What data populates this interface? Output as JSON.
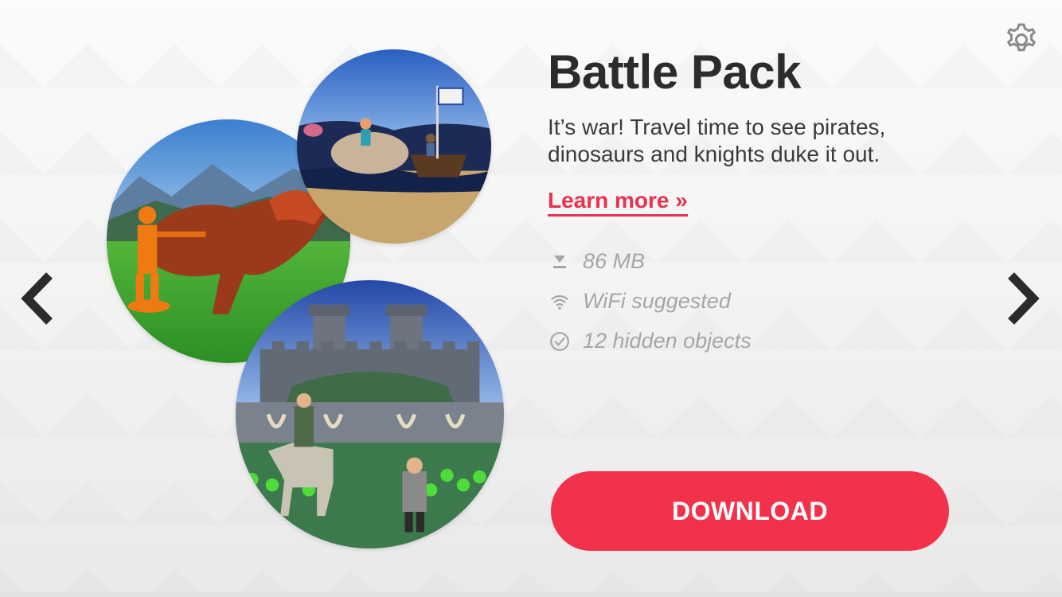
{
  "pack": {
    "title": "Battle Pack",
    "description": "It’s war! Travel time to see pirates, dinosaurs and knights duke it out.",
    "learn_more": "Learn more »",
    "info": {
      "size": "86 MB",
      "connection": "WiFi suggested",
      "hidden_objects": "12 hidden objects"
    },
    "download_label": "DOWNLOAD"
  },
  "icons": {
    "settings": "gear-icon",
    "prev": "chevron-left-icon",
    "next": "chevron-right-icon",
    "size": "download-icon",
    "connection": "wifi-icon",
    "hidden_objects": "check-circle-icon"
  },
  "colors": {
    "accent": "#f2314b",
    "link": "#e8324e",
    "title": "#2c2c2c",
    "muted": "#a6a6a6"
  }
}
